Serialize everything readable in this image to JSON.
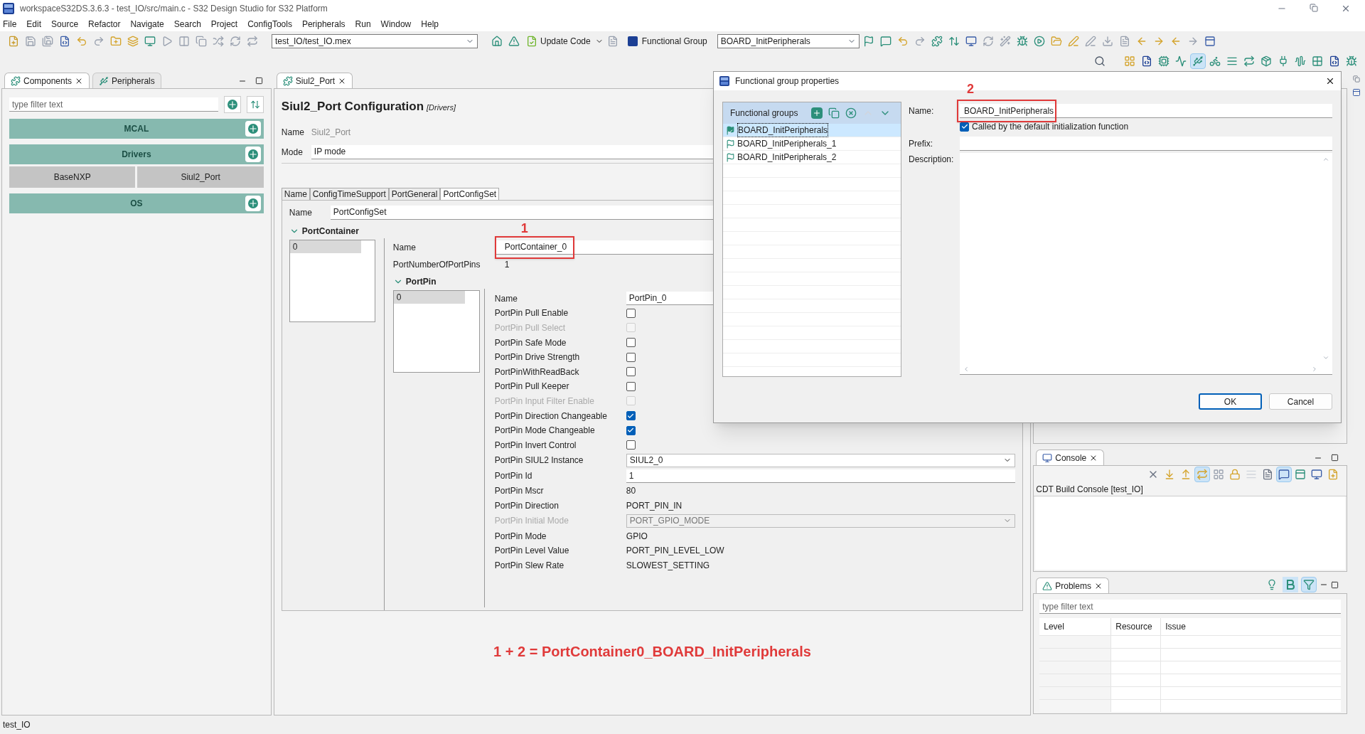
{
  "window": {
    "title": "workspaceS32DS.3.6.3 - test_IO/src/main.c - S32 Design Studio for S32 Platform"
  },
  "menu": [
    "File",
    "Edit",
    "Source",
    "Refactor",
    "Navigate",
    "Search",
    "Project",
    "ConfigTools",
    "Peripherals",
    "Run",
    "Window",
    "Help"
  ],
  "toolbar": {
    "project_combo": "test_IO/test_IO.mex",
    "update_code": "Update Code",
    "functional_group_label": "Functional Group",
    "functional_group_combo": "BOARD_InitPeripherals"
  },
  "left_panel": {
    "tabs": [
      {
        "label": "Components",
        "selected": true
      },
      {
        "label": "Peripherals",
        "selected": false
      }
    ],
    "filter": {
      "placeholder": "type filter text"
    },
    "categories": [
      {
        "name": "MCAL"
      },
      {
        "name": "Drivers",
        "components": [
          "BaseNXP",
          "Siul2_Port"
        ]
      },
      {
        "name": "OS"
      }
    ]
  },
  "editor": {
    "tab": "Siul2_Port",
    "heading": "Siul2_Port Configuration",
    "tag": "[Drivers]",
    "name_label": "Name",
    "name_value": "Siul2_Port",
    "mode_label": "Mode",
    "mode_value": "IP mode",
    "subtabs": [
      {
        "label": "Name",
        "selected": false
      },
      {
        "label": "ConfigTimeSupport",
        "selected": false
      },
      {
        "label": "PortGeneral",
        "selected": false
      },
      {
        "label": "PortConfigSet",
        "selected": true
      }
    ],
    "config_name_label": "Name",
    "config_name_value": "PortConfigSet",
    "container_section": {
      "title": "PortContainer",
      "expanded": true
    },
    "container_items": [
      {
        "label": "0",
        "selected": true
      }
    ],
    "container_fields": [
      {
        "label": "Name",
        "kind": "input",
        "value": "PortContainer_0",
        "highlighted": true,
        "note": "1"
      },
      {
        "label": "PortNumberOfPortPins",
        "kind": "text",
        "value": "1"
      }
    ],
    "pin_section": {
      "title": "PortPin",
      "expanded": true
    },
    "pin_items": [
      {
        "label": "0",
        "selected": true
      }
    ],
    "pin_fields": [
      {
        "label": "Name",
        "kind": "input",
        "value": "PortPin_0",
        "disabled": false
      },
      {
        "label": "PortPin Pull Enable",
        "kind": "checkbox",
        "checked": false,
        "disabled": false
      },
      {
        "label": "PortPin Pull Select",
        "kind": "checkbox",
        "checked": false,
        "disabled": true
      },
      {
        "label": "PortPin Safe Mode",
        "kind": "checkbox",
        "checked": false,
        "disabled": false
      },
      {
        "label": "PortPin Drive Strength",
        "kind": "checkbox",
        "checked": false,
        "disabled": false
      },
      {
        "label": "PortPinWithReadBack",
        "kind": "checkbox",
        "checked": false,
        "disabled": false
      },
      {
        "label": "PortPin Pull Keeper",
        "kind": "checkbox",
        "checked": false,
        "disabled": false
      },
      {
        "label": "PortPin Input Filter Enable",
        "kind": "checkbox",
        "checked": false,
        "disabled": true
      },
      {
        "label": "PortPin Direction Changeable",
        "kind": "checkbox",
        "checked": true,
        "disabled": false
      },
      {
        "label": "PortPin Mode Changeable",
        "kind": "checkbox",
        "checked": true,
        "disabled": false
      },
      {
        "label": "PortPin Invert Control",
        "kind": "checkbox",
        "checked": false,
        "disabled": false
      },
      {
        "label": "PortPin SIUL2 Instance",
        "kind": "select",
        "value": "SIUL2_0",
        "disabled": false
      },
      {
        "label": "PortPin Id",
        "kind": "input",
        "value": "1",
        "disabled": false
      },
      {
        "label": "PortPin Mscr",
        "kind": "text",
        "value": "80",
        "disabled": false
      },
      {
        "label": "PortPin Direction",
        "kind": "text",
        "value": "PORT_PIN_IN",
        "disabled": false
      },
      {
        "label": "PortPin Initial Mode",
        "kind": "select",
        "value": "PORT_GPIO_MODE",
        "disabled": true
      },
      {
        "label": "PortPin Mode",
        "kind": "text",
        "value": "GPIO",
        "disabled": false
      },
      {
        "label": "PortPin Level Value",
        "kind": "text",
        "value": "PORT_PIN_LEVEL_LOW",
        "disabled": false
      },
      {
        "label": "PortPin Slew Rate",
        "kind": "text",
        "value": "SLOWEST_SETTING",
        "disabled": false
      }
    ]
  },
  "annotation": "1 + 2 = PortContainer0_BOARD_InitPeripherals",
  "dialog": {
    "title": "Functional group properties",
    "groups_label": "Functional groups",
    "groups": [
      {
        "name": "BOARD_InitPeripherals",
        "selected": true,
        "default": true
      },
      {
        "name": "BOARD_InitPeripherals_1",
        "selected": false,
        "default": false
      },
      {
        "name": "BOARD_InitPeripherals_2",
        "selected": false,
        "default": false
      }
    ],
    "name_label": "Name:",
    "name_value": "BOARD_InitPeripherals",
    "name_highlighted": true,
    "name_note": "2",
    "called_by_default": {
      "label": "Called by the default initialization function",
      "checked": true
    },
    "prefix_label": "Prefix:",
    "description_label": "Description:",
    "buttons": [
      {
        "label": "OK",
        "default": true
      },
      {
        "label": "Cancel",
        "default": false
      }
    ]
  },
  "console": {
    "tab": "Console",
    "title": "CDT Build Console [test_IO]"
  },
  "problems": {
    "tab": "Problems",
    "filter": {
      "placeholder": "type filter text"
    },
    "columns": [
      "Level",
      "Resource",
      "Issue"
    ]
  },
  "status_bar": "test_IO"
}
